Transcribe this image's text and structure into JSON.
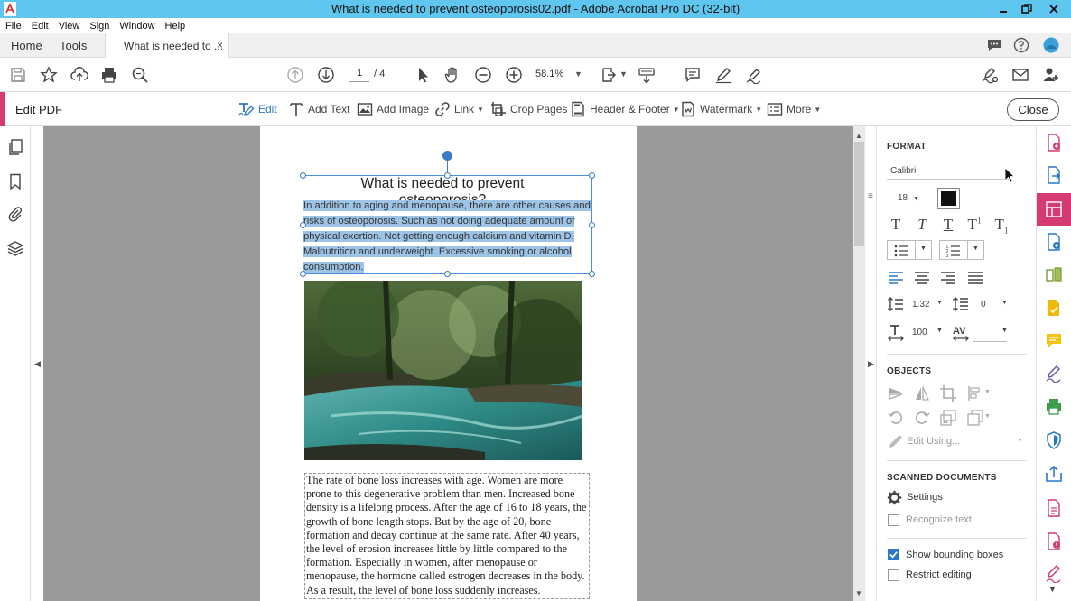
{
  "window": {
    "title": "What is needed to prevent osteoporosis02.pdf - Adobe Acrobat Pro DC (32-bit)"
  },
  "menu": [
    "File",
    "Edit",
    "View",
    "Sign",
    "Window",
    "Help"
  ],
  "tabs": {
    "home": "Home",
    "tools": "Tools",
    "doc": "What is needed to ...",
    "close": "×"
  },
  "toolbar": {
    "page_current": "1",
    "page_total": "/ 4",
    "zoom": "58.1%"
  },
  "editbar": {
    "title": "Edit PDF",
    "edit": "Edit",
    "add_text": "Add Text",
    "add_image": "Add Image",
    "link": "Link",
    "crop": "Crop Pages",
    "header_footer": "Header & Footer",
    "watermark": "Watermark",
    "more": "More",
    "close": "Close"
  },
  "document": {
    "heading": "What is needed to prevent osteoporosis?",
    "para1_lines": [
      "In addition to aging and menopause, there are other causes and",
      "risks of osteoporosis. Such as not doing adequate amount of",
      "physical exertion. Not getting enough calcium and vitamin D.",
      "Malnutrition and underweight. Excessive smoking or alcohol",
      "consumption."
    ],
    "para2_lines": [
      "The rate of bone loss increases with age. Women are more",
      "prone to this degenerative problem than men. Increased bone",
      "density is a lifelong process. After the age of 16 to 18 years, the",
      "growth of bone length stops. But by the age of 20, bone",
      "formation and decay continue at the same rate. After 40 years,",
      "the level of erosion increases little by little compared to the",
      "formation. Especially in women, after menopause or",
      "menopause, the hormone called estrogen decreases in the body.",
      "As a result, the level of bone loss suddenly increases."
    ]
  },
  "format_panel": {
    "format_title": "FORMAT",
    "font": "Calibri",
    "size": "18",
    "line_spacing": "1.32",
    "para_spacing": "0",
    "h_scale": "100",
    "objects_title": "OBJECTS",
    "edit_using": "Edit Using...",
    "scanned_title": "SCANNED DOCUMENTS",
    "settings": "Settings",
    "recognize_text": "Recognize text",
    "show_bounding": "Show bounding boxes",
    "show_bounding_checked": true,
    "restrict_editing": "Restrict editing",
    "restrict_editing_checked": false
  },
  "colors": {
    "titlebar": "#5ec6ef",
    "accent": "#d43b72",
    "selection": "#9dc3e6",
    "link_blue": "#2b78c5"
  }
}
